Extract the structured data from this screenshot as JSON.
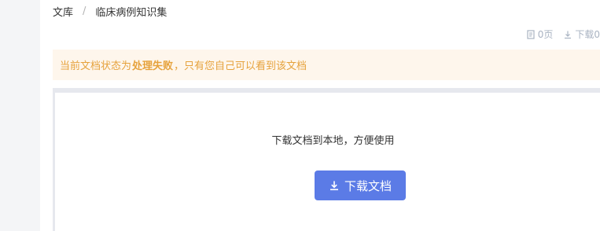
{
  "breadcrumb": {
    "root": "文库",
    "separator": "/",
    "current": "临床病例知识集"
  },
  "meta": {
    "pages": "0页",
    "downloads": "下载0"
  },
  "notice": {
    "prefix": "当前文档状态为",
    "status": "处理失败",
    "suffix": "，只有您自己可以看到该文档"
  },
  "viewer": {
    "hint": "下载文档到本地，方便使用",
    "download_label": "下载文档"
  },
  "colors": {
    "accent": "#5b7be6",
    "warning_text": "#e6a23c",
    "warning_bg": "#fef6ec"
  }
}
